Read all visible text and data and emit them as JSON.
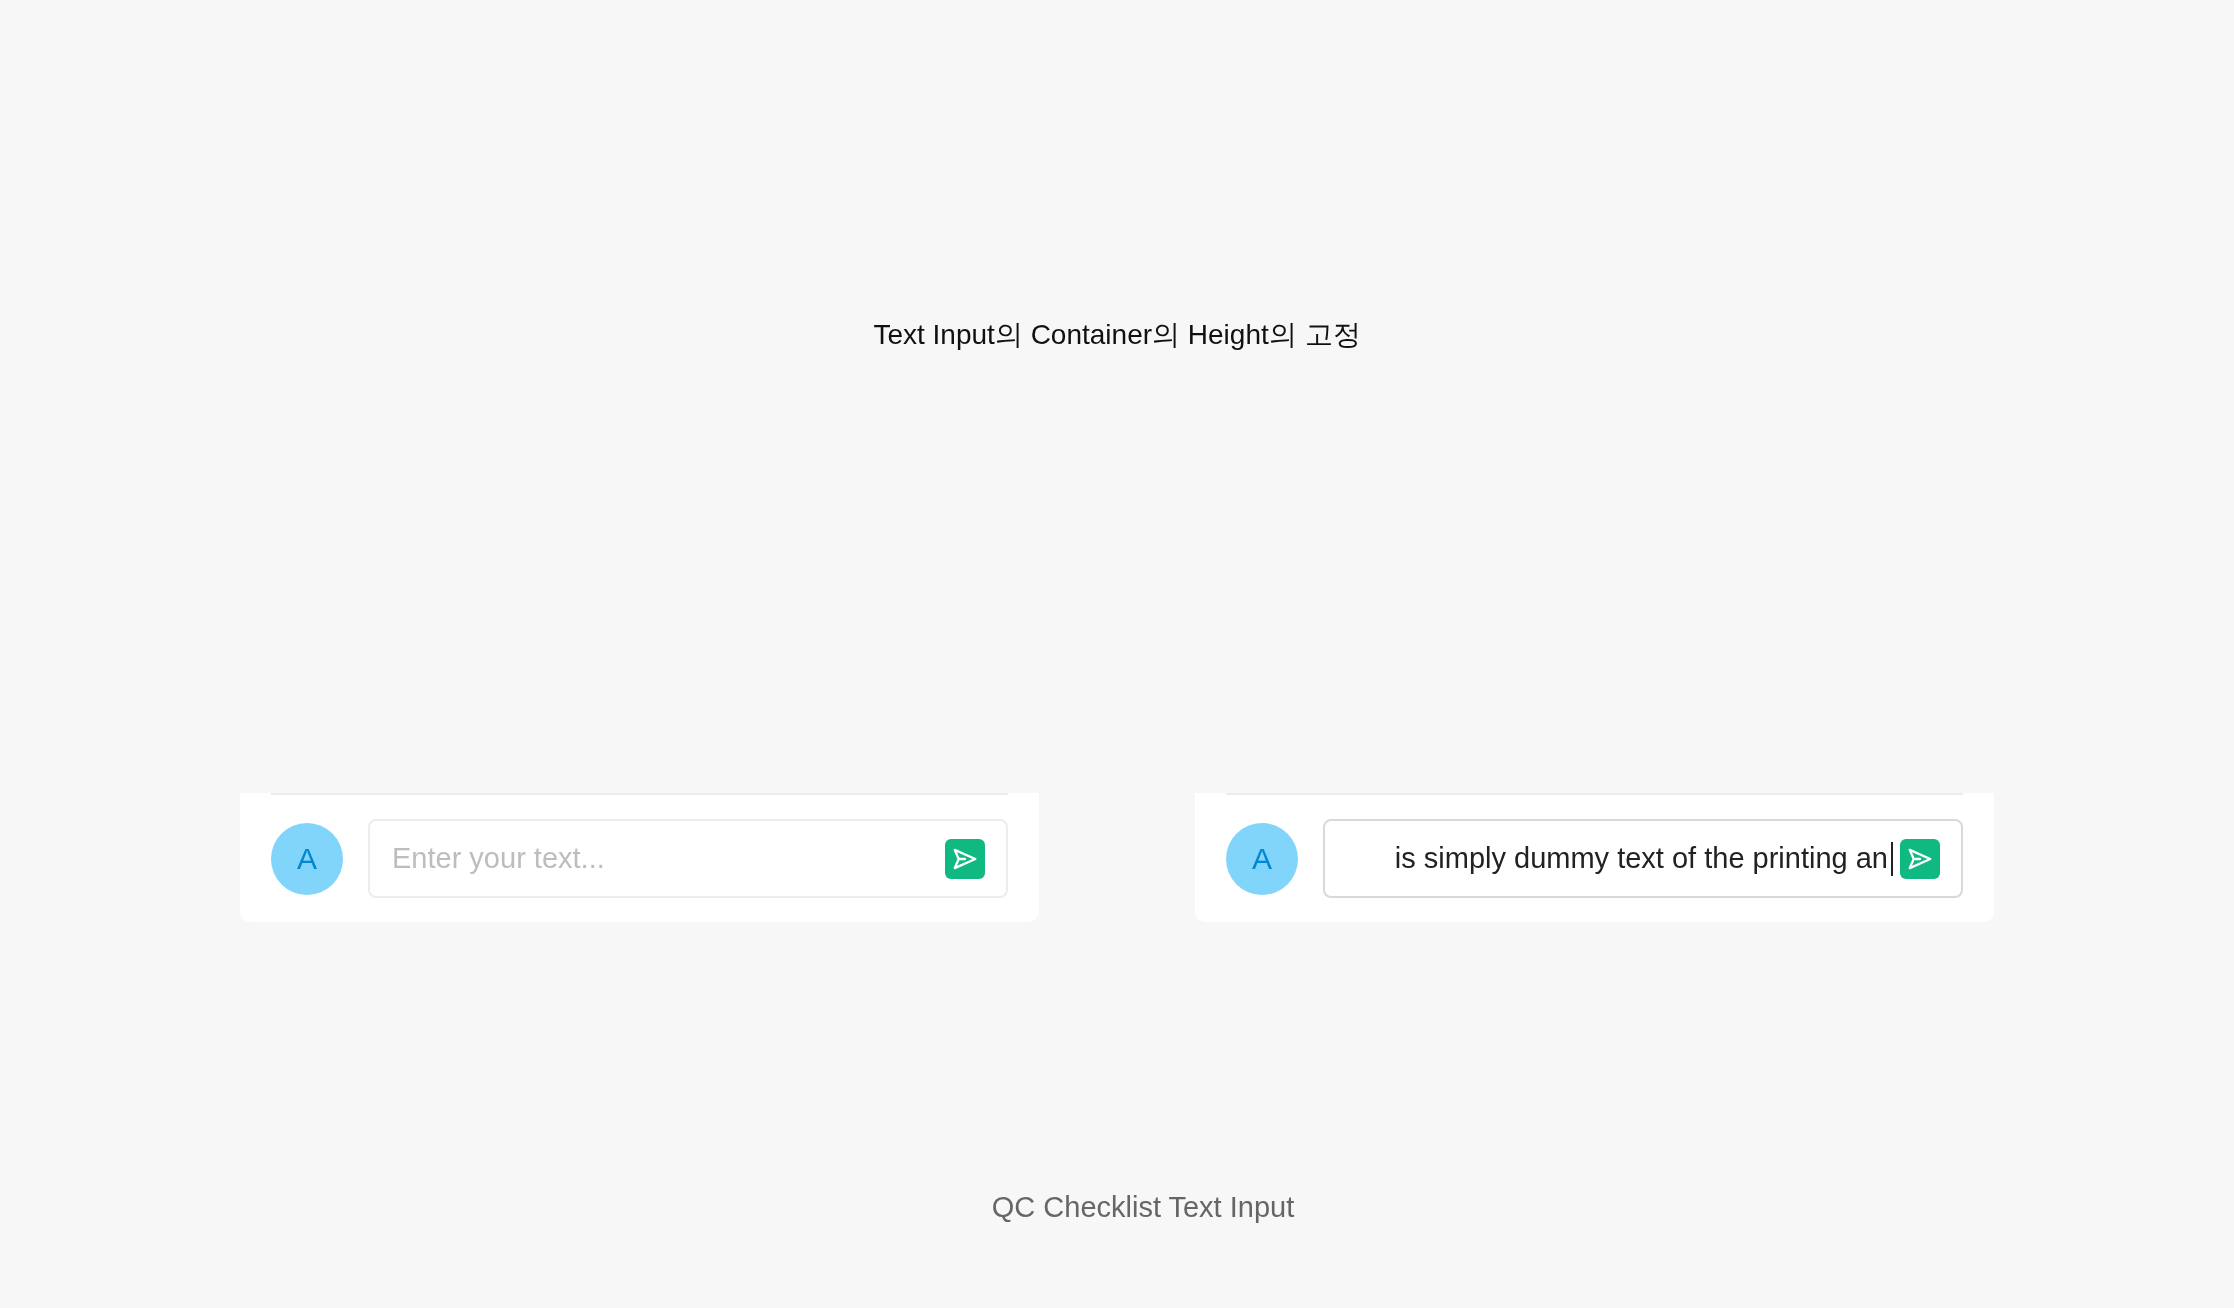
{
  "title": "Text Input의 Container의 Height의 고정",
  "examples": [
    {
      "avatar": "A",
      "input": {
        "placeholder": "Enter your text...",
        "focused": false
      }
    },
    {
      "avatar": "A",
      "input": {
        "value": "is simply dummy text of the printing an",
        "focused": true
      }
    }
  ],
  "footer": "QC Checklist Text Input"
}
